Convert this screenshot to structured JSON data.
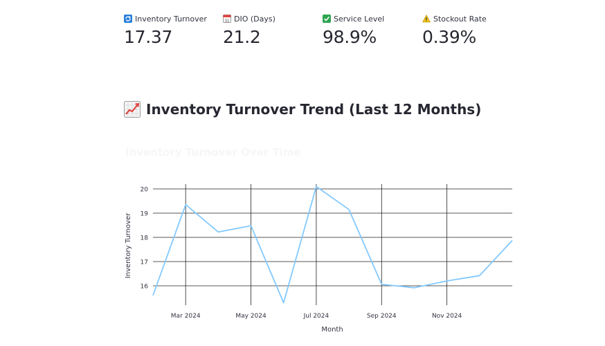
{
  "metrics": [
    {
      "label": "Inventory Turnover",
      "value": "17.37",
      "icon": "refresh-icon"
    },
    {
      "label": "DIO (Days)",
      "value": "21.2",
      "icon": "calendar-icon"
    },
    {
      "label": "Service Level",
      "value": "98.9%",
      "icon": "check-icon"
    },
    {
      "label": "Stockout Rate",
      "value": "0.39%",
      "icon": "warning-icon"
    }
  ],
  "section": {
    "title": "Inventory Turnover Trend (Last 12 Months)",
    "icon": "chart-increasing-icon"
  },
  "chart_data": {
    "type": "line",
    "title": "Inventory Turnover Over Time",
    "xlabel": "Month",
    "ylabel": "Inventory Turnover",
    "x": [
      "2024-02",
      "2024-03",
      "2024-04",
      "2024-05",
      "2024-06",
      "2024-07",
      "2024-08",
      "2024-09",
      "2024-10",
      "2024-11",
      "2024-12",
      "2025-01"
    ],
    "x_tick_labels": [
      "Mar 2024",
      "May 2024",
      "Jul 2024",
      "Sep 2024",
      "Nov 2024"
    ],
    "x_tick_values": [
      "2024-03",
      "2024-05",
      "2024-07",
      "2024-09",
      "2024-11"
    ],
    "y_ticks": [
      16,
      17,
      18,
      19,
      20
    ],
    "ylim": [
      15.2,
      20.2
    ],
    "series": [
      {
        "values": [
          15.6,
          19.35,
          18.22,
          18.48,
          15.3,
          20.1,
          19.15,
          16.06,
          15.92,
          16.2,
          16.42,
          17.87
        ],
        "color": "#83c9ff"
      }
    ],
    "grid": true
  }
}
